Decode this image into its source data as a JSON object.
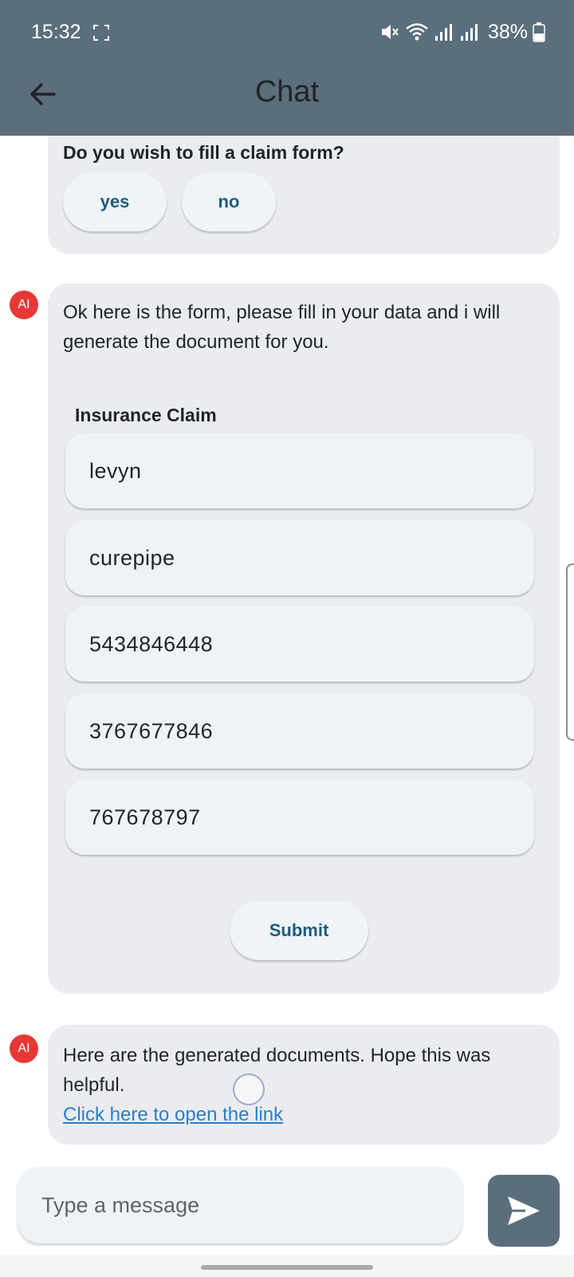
{
  "status_bar": {
    "time": "15:32",
    "battery": "38%"
  },
  "app_bar": {
    "title": "Chat"
  },
  "messages": [
    {
      "question": "Do you wish to fill a claim form?",
      "options": [
        "yes",
        "no"
      ]
    },
    {
      "avatar": "AI",
      "text": "Ok here is the form, please fill in your data and i will generate the document for you.",
      "form": {
        "title": "Insurance Claim",
        "fields": [
          "levyn",
          "curepipe",
          "5434846448",
          "3767677846",
          "767678797"
        ],
        "submit_label": "Submit"
      }
    },
    {
      "avatar": "AI",
      "text": "Here are the generated documents. Hope this was helpful.",
      "link_text": "Click here to open the link"
    }
  ],
  "composer": {
    "placeholder": "Type a message"
  },
  "colors": {
    "app_bar": "#5b6e7b",
    "bubble": "#ebecef",
    "avatar": "#e53935",
    "accent_text": "#1b5e78",
    "link": "#2a7fc7"
  },
  "icons": {
    "back": "arrow-left-icon",
    "send": "send-icon",
    "mute": "mute-icon",
    "wifi": "wifi-icon",
    "signal": "signal-icon",
    "battery": "battery-icon"
  }
}
